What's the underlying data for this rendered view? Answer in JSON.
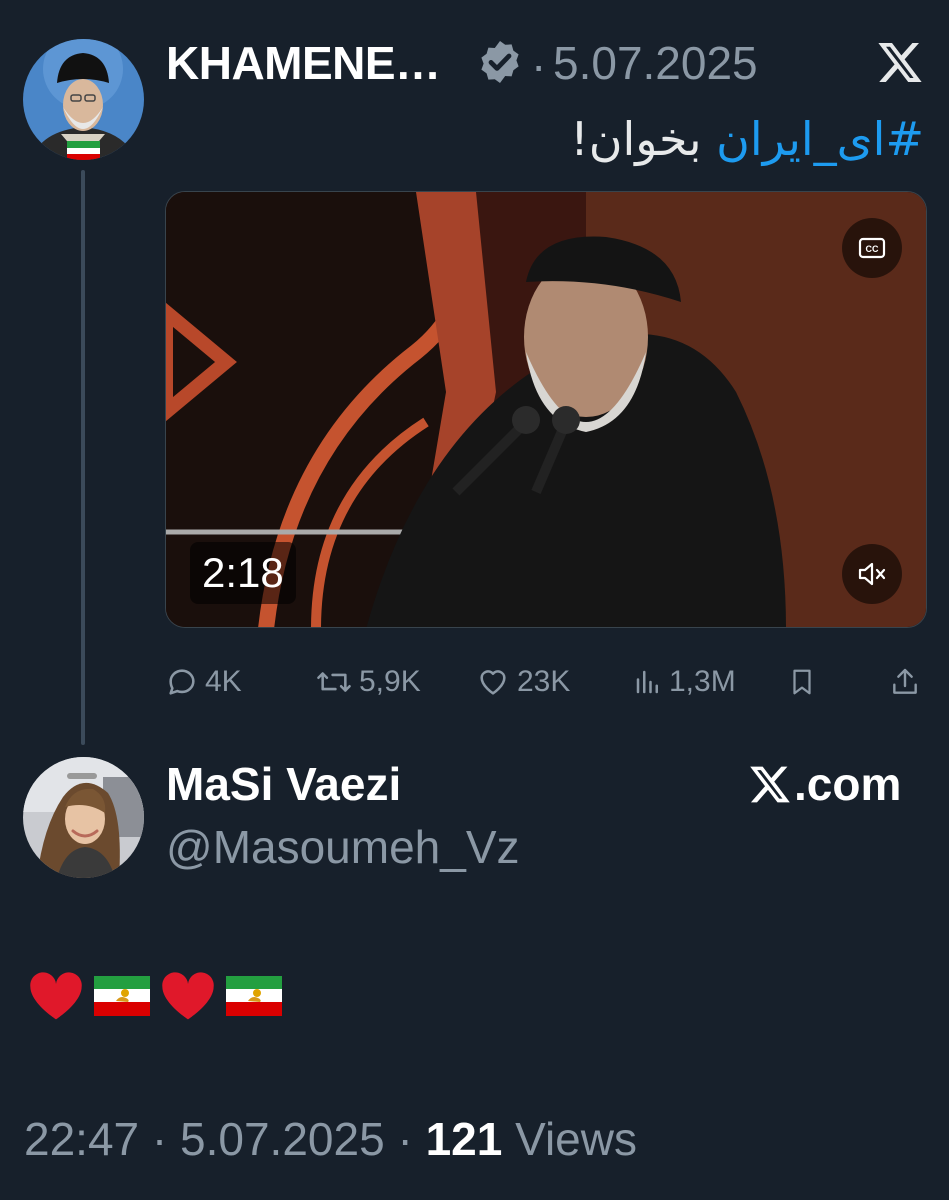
{
  "quoted_tweet": {
    "author_name": "KHAMENE…",
    "date": "5.07.2025",
    "separator": "·",
    "text_hashtag": "#ای_ایران",
    "text_rest": "بخوان!",
    "video": {
      "duration": "2:18",
      "cc_icon": "closed-captions-icon",
      "mute_icon": "muted-speaker-icon"
    },
    "stats": {
      "replies": "4K",
      "reposts": "5,9K",
      "likes": "23K",
      "views": "1,3M"
    }
  },
  "reply": {
    "author_name": "MaSi Vaezi",
    "handle": "@Masoumeh_Vz",
    "watermark": ".com",
    "emoji_text": "❤️🇮🇷❤️🇮🇷",
    "time": "22:47",
    "date": "5.07.2025",
    "views_count": "121",
    "views_label": "Views",
    "separator": "·"
  },
  "colors": {
    "background": "#17202b",
    "accent": "#1d9bf0",
    "secondary_text": "#8b98a5",
    "primary_text": "#e7e9ea"
  }
}
